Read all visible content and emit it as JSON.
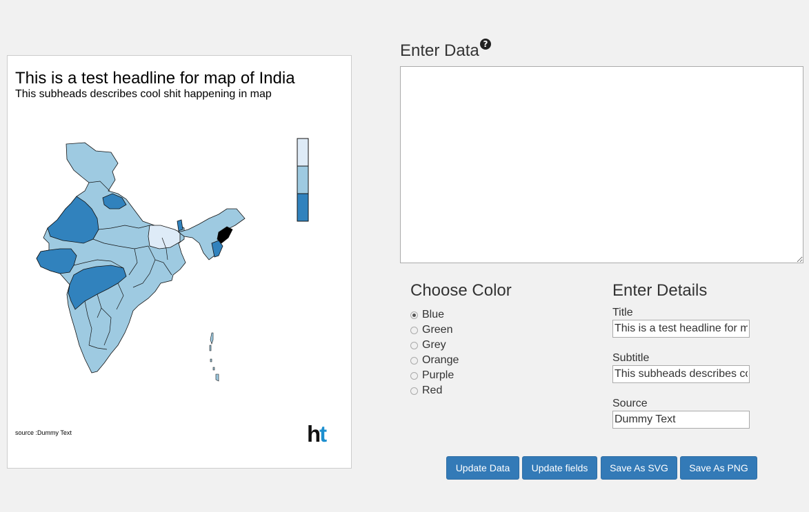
{
  "map": {
    "title": "This is a test headline for map of India",
    "subtitle": "This subheads describes cool shit happening in map",
    "source": "source :Dummy Text",
    "logo_h": "h",
    "logo_t": "t",
    "palette": [
      "#deebf7",
      "#9ecae1",
      "#3182bd"
    ],
    "highlight_color": "#000000"
  },
  "data_panel": {
    "heading": "Enter Data",
    "help_icon": "question-circle-icon",
    "textarea_value": ""
  },
  "color_panel": {
    "heading": "Choose Color",
    "options": [
      "Blue",
      "Green",
      "Grey",
      "Orange",
      "Purple",
      "Red"
    ],
    "selected": "Blue"
  },
  "details_panel": {
    "heading": "Enter Details",
    "title_label": "Title",
    "title_value": "This is a test headline for map of India",
    "subtitle_label": "Subtitle",
    "subtitle_value": "This subheads describes cool shit happening in map",
    "source_label": "Source",
    "source_value": "Dummy Text"
  },
  "buttons": {
    "update_data": "Update Data",
    "update_fields": "Update fields",
    "save_svg": "Save As SVG",
    "save_png": "Save As PNG"
  }
}
